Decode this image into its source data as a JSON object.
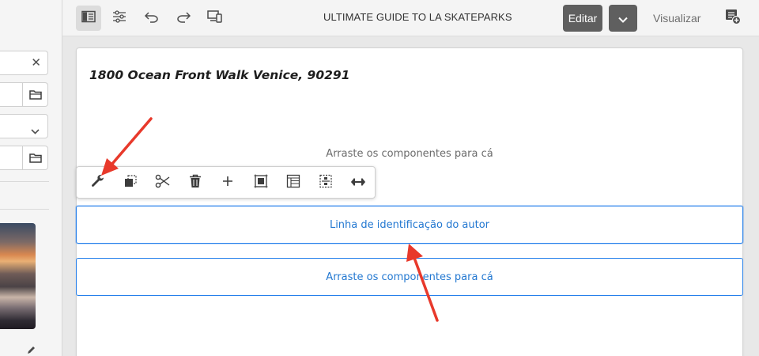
{
  "sidebar": {
    "clear_symbol": "✕"
  },
  "topbar": {
    "title": "ULTIMATE GUIDE TO LA SKATEPARKS",
    "edit_label": "Editar",
    "preview_label": "Visualizar",
    "icons": [
      "toggle-side-panel-icon",
      "page-properties-icon",
      "undo-icon",
      "redo-icon",
      "emulator-icon",
      "mode-chevron-icon",
      "annotations-icon"
    ]
  },
  "page": {
    "address": "1800 Ocean Front Walk Venice, 90291",
    "drop_placeholder": "Arraste os componentes para cá",
    "byline_component": "Linha de identificação do autor",
    "drop_placeholder_2": "Arraste os componentes para cá"
  },
  "component_toolbar": {
    "icons": [
      "configure-wrench-icon",
      "copy-icon",
      "cut-icon",
      "delete-icon",
      "insert-plus-icon",
      "group-icon",
      "layout-icon",
      "parent-icon",
      "resize-icon"
    ]
  },
  "annotation_color": "#e8392b",
  "accent_color": "#2680eb"
}
